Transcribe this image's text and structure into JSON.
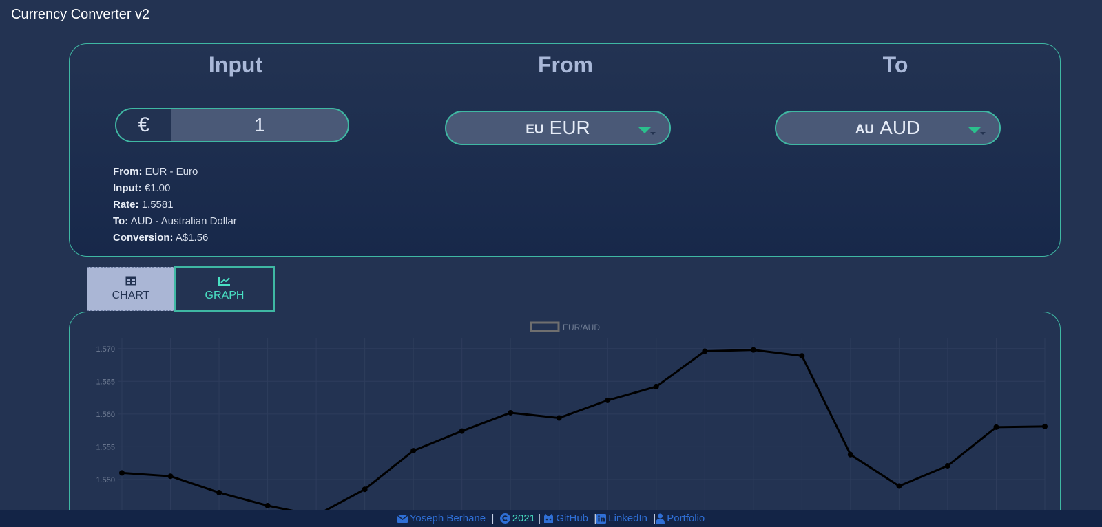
{
  "app": {
    "title": "Currency Converter v2"
  },
  "converter": {
    "input_header": "Input",
    "from_header": "From",
    "to_header": "To",
    "amount_symbol": "€",
    "amount_value": "1",
    "from_select": {
      "flag": "EU",
      "code": "EUR"
    },
    "to_select": {
      "flag": "AU",
      "code": "AUD"
    },
    "details": [
      {
        "label": "From:",
        "value": "EUR - Euro"
      },
      {
        "label": "Input:",
        "value": "€1.00"
      },
      {
        "label": "Rate:",
        "value": "1.5581"
      },
      {
        "label": "To:",
        "value": "AUD - Australian Dollar"
      },
      {
        "label": "Conversion:",
        "value": "A$1.56"
      }
    ]
  },
  "tabs": [
    {
      "label": "CHART",
      "icon": "table-icon",
      "active": false
    },
    {
      "label": "GRAPH",
      "icon": "line-chart-icon",
      "active": true
    }
  ],
  "chart_data": {
    "type": "line",
    "series": [
      {
        "name": "EUR/AUD",
        "values": [
          1.551,
          1.5505,
          1.548,
          1.546,
          1.5445,
          1.5485,
          1.5544,
          1.5574,
          1.5602,
          1.5594,
          1.5621,
          1.5642,
          1.5696,
          1.5698,
          1.5689,
          1.5538,
          1.549,
          1.5521,
          1.558,
          1.5581
        ]
      }
    ],
    "yticks": [
      "1.570",
      "1.565",
      "1.560",
      "1.555",
      "1.550"
    ],
    "ylim": [
      1.544,
      1.5705
    ],
    "legend": "top",
    "grid": true
  },
  "footer": {
    "author": "Yoseph Berhane",
    "year": "2021",
    "github": "GitHub",
    "linkedin": "LinkedIn",
    "portfolio": "Portfolio",
    "sep": "|"
  },
  "colors": {
    "accent": "#3fb8a3",
    "background": "#233352",
    "link": "#2f6fd6"
  }
}
